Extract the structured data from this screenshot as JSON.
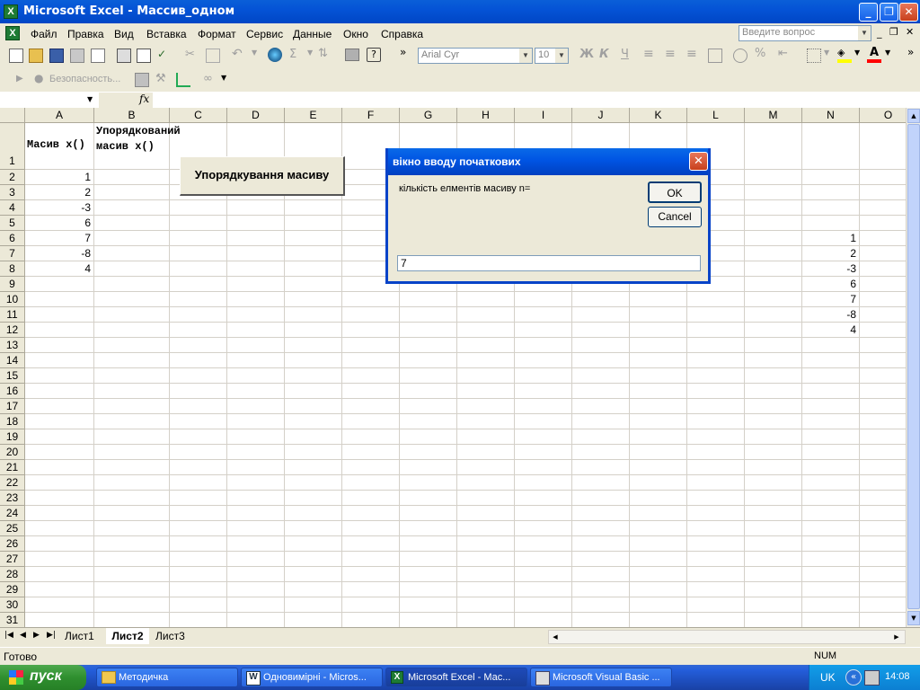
{
  "window": {
    "title": "Microsoft Excel - Массив_одном"
  },
  "menu": {
    "items": [
      "Файл",
      "Правка",
      "Вид",
      "Вставка",
      "Формат",
      "Сервис",
      "Данные",
      "Окно",
      "Справка"
    ],
    "help_placeholder": "Введите вопрос"
  },
  "toolbar": {
    "font_name": "Arial Cyr",
    "font_size": "10",
    "security_label": "Безопасность...",
    "bold": "Ж",
    "italic": "К",
    "underline": "Ч",
    "percent": "%",
    "sigma": "Σ"
  },
  "formula_bar": {
    "fx": "fx"
  },
  "grid": {
    "columns": [
      "A",
      "B",
      "C",
      "D",
      "E",
      "F",
      "G",
      "H",
      "I",
      "J",
      "K",
      "L",
      "M",
      "N",
      "O"
    ],
    "rows": [
      "1",
      "2",
      "3",
      "4",
      "5",
      "6",
      "7",
      "8",
      "9",
      "10",
      "11",
      "12",
      "13",
      "14",
      "15",
      "16",
      "17",
      "18",
      "19",
      "20",
      "21",
      "22",
      "23",
      "24",
      "25",
      "26",
      "27",
      "28",
      "29",
      "30",
      "31"
    ],
    "header_a": "Масив x()",
    "header_b": "Упорядкований масив x()",
    "col_a_values": [
      "1",
      "2",
      "-3",
      "6",
      "7",
      "-8",
      "4"
    ],
    "col_n_values": [
      "1",
      "2",
      "-3",
      "6",
      "7",
      "-8",
      "4"
    ],
    "sort_button": "Упорядкування масиву"
  },
  "dialog": {
    "title": "вікно вводу початкових",
    "prompt": "кількість елментів масиву n=",
    "ok": "OK",
    "cancel": "Cancel",
    "input_value": "7"
  },
  "sheets": {
    "tabs": [
      "Лист1",
      "Лист2",
      "Лист3"
    ],
    "active": "Лист2"
  },
  "status": {
    "ready": "Готово",
    "num": "NUM"
  },
  "taskbar": {
    "start": "пуск",
    "tasks": [
      "Методичка",
      "Одновимірні - Micros...",
      "Microsoft Excel - Мас...",
      "Microsoft Visual Basic ..."
    ],
    "lang": "UK",
    "time": "14:08"
  },
  "colors": {
    "title_blue": "#0054e3",
    "excel_green": "#1e7b34",
    "start_green": "#3a9b3a"
  }
}
